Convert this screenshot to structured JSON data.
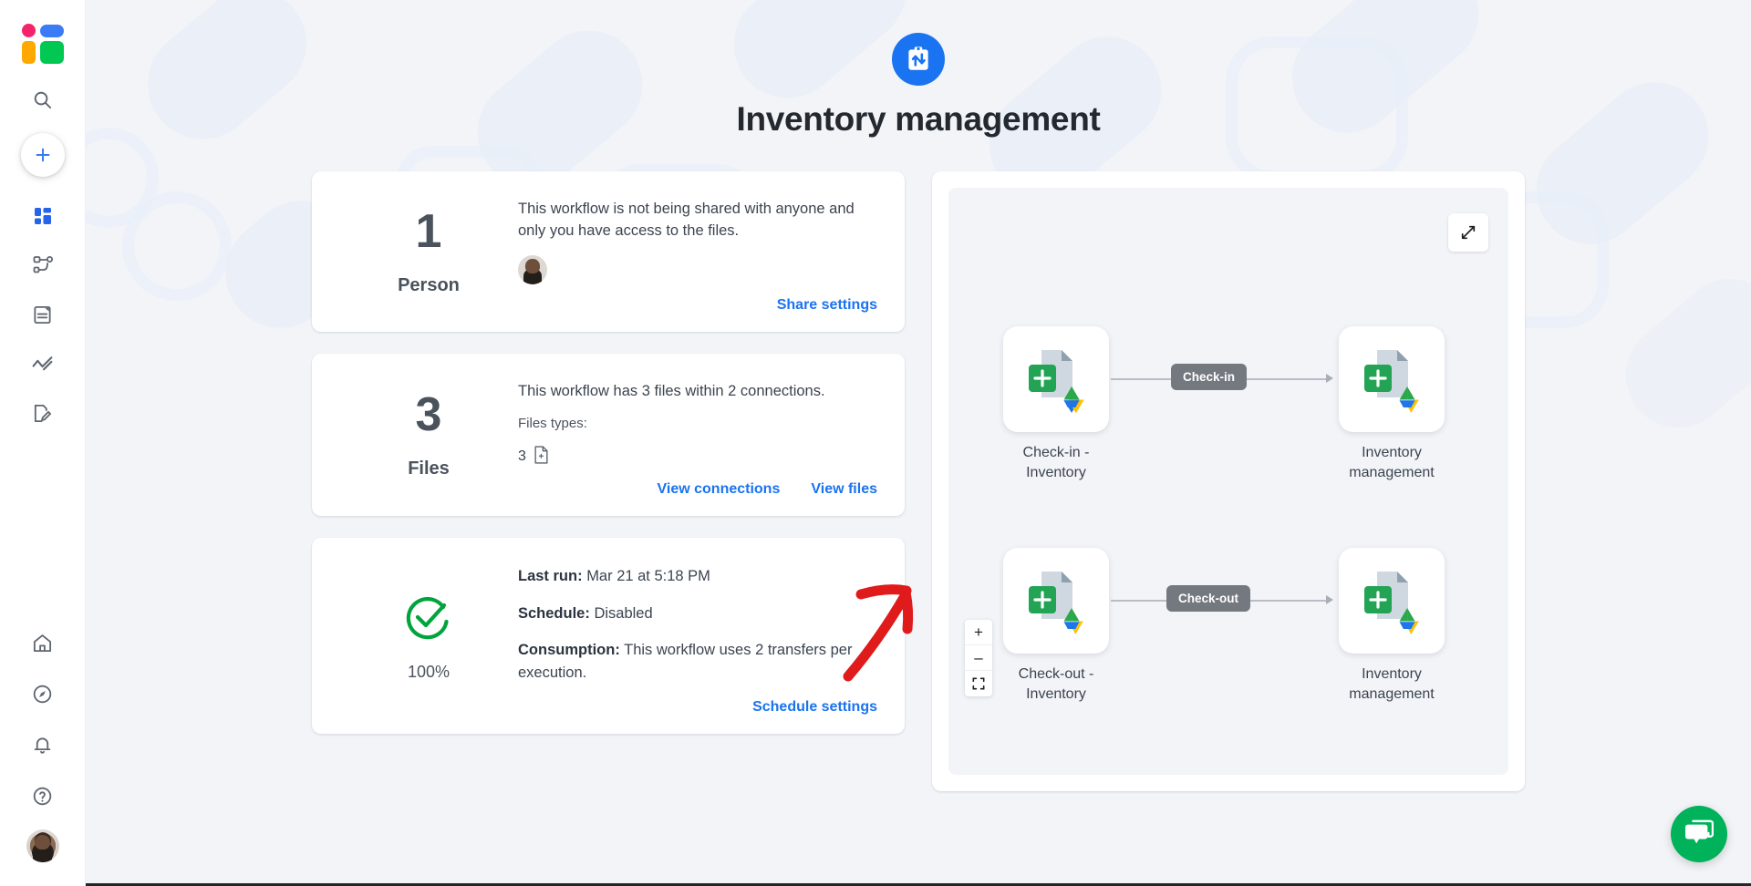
{
  "sidebar": {
    "logo_name": "app-logo",
    "items": [
      {
        "name": "search-icon",
        "label": "Search"
      },
      {
        "name": "create-new-button",
        "label": "Create new"
      },
      {
        "name": "sidebar-item-dashboard",
        "label": "Dashboard"
      },
      {
        "name": "sidebar-item-workflows",
        "label": "Workflows"
      },
      {
        "name": "sidebar-item-logs",
        "label": "Logs"
      },
      {
        "name": "sidebar-item-analytics",
        "label": "Analytics"
      },
      {
        "name": "sidebar-item-templates",
        "label": "Templates"
      },
      {
        "name": "sidebar-item-home",
        "label": "Home"
      },
      {
        "name": "sidebar-item-explore",
        "label": "Explore"
      },
      {
        "name": "sidebar-item-notifications",
        "label": "Notifications"
      },
      {
        "name": "sidebar-item-help",
        "label": "Help"
      },
      {
        "name": "sidebar-avatar",
        "label": "Account"
      }
    ]
  },
  "header": {
    "app_icon": "clipboard-transfer-icon",
    "title": "Inventory management"
  },
  "cards": {
    "people": {
      "count": "1",
      "unit": "Person",
      "description": "This workflow is not being shared with anyone and only you have access to the files.",
      "avatar": "user-avatar",
      "action": "Share settings"
    },
    "files": {
      "count": "3",
      "unit": "Files",
      "description": "This workflow has 3 files within 2 connections.",
      "types_label": "Files types:",
      "type_count": "3",
      "type_icon": "sheets-file-icon",
      "actions": [
        {
          "name": "view-connections-link",
          "label": "View connections"
        },
        {
          "name": "view-files-link",
          "label": "View files"
        }
      ]
    },
    "status": {
      "percent": "100%",
      "icon": "success-check-icon",
      "rows": [
        {
          "key": "Last run:",
          "value": "Mar 21 at 5:18 PM"
        },
        {
          "key": "Schedule:",
          "value": "Disabled"
        },
        {
          "key": "Consumption:",
          "value": "This workflow uses 2 transfers per execution."
        }
      ],
      "action": "Schedule settings"
    }
  },
  "diagram": {
    "expand_button": "expand-diagram-button",
    "zoom_controls": [
      {
        "name": "zoom-in-button",
        "glyph": "+"
      },
      {
        "name": "zoom-out-button",
        "glyph": "–"
      },
      {
        "name": "fit-view-button",
        "glyph": "fit"
      }
    ],
    "flows": [
      {
        "source_label": "Check-in - Inventory",
        "edge_label": "Check-in",
        "target_label": "Inventory management",
        "source_icon": "google-sheets-drive-file-icon",
        "target_icon": "google-sheets-drive-file-icon"
      },
      {
        "source_label": "Check-out - Inventory",
        "edge_label": "Check-out",
        "target_label": "Inventory management",
        "source_icon": "google-sheets-drive-file-icon",
        "target_icon": "google-sheets-drive-file-icon"
      }
    ]
  },
  "annotation": {
    "name": "red-arrow-annotation",
    "points_to": "view-files-link",
    "color": "#e01b1b"
  },
  "chat": {
    "name": "chat-support-button",
    "icon": "chat-bubbles-icon",
    "color": "#00b259"
  },
  "colors": {
    "accent": "#1a73f0",
    "success": "#00a43c",
    "chip": "#74787f",
    "page_bg": "#f2f4f8"
  }
}
